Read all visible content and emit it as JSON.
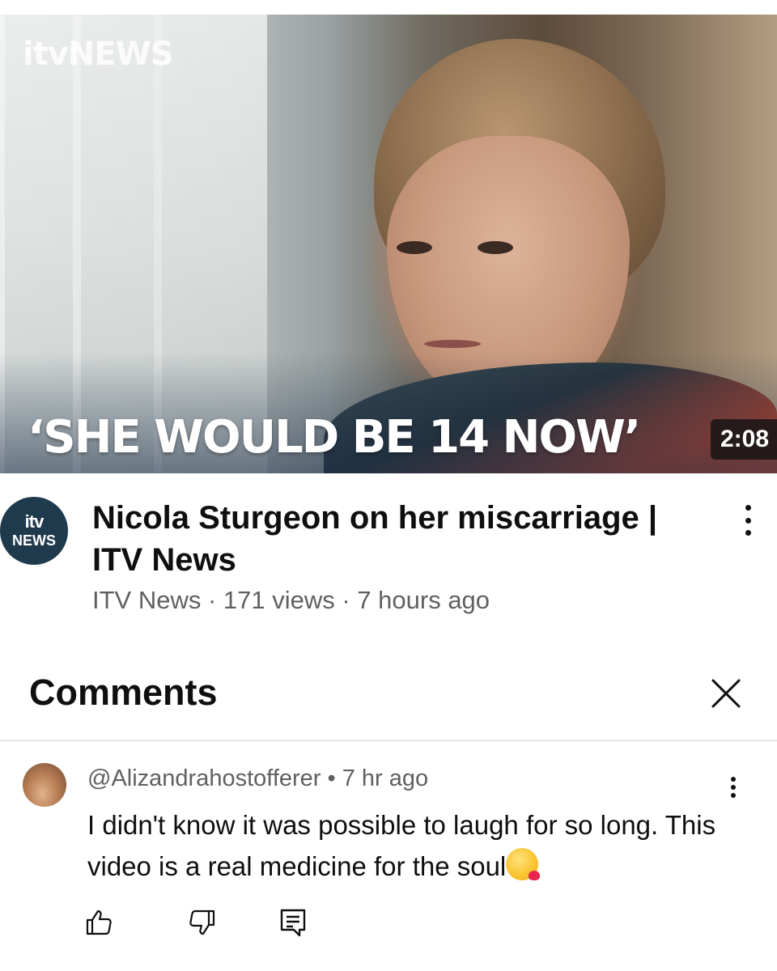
{
  "video": {
    "thumbnail": {
      "channel_logo_text": "itvNEWS",
      "caption": "‘SHE WOULD BE 14 NOW’",
      "duration": "2:08"
    },
    "channel_avatar": {
      "line1": "itv",
      "line2": "NEWS"
    },
    "title": "Nicola Sturgeon on her miscarriage | ITV News",
    "meta": "ITV News · 171 views · 7 hours ago"
  },
  "comments": {
    "heading": "Comments",
    "items": [
      {
        "author": "@Alizandrahostofferer",
        "time": "7 hr ago",
        "author_line": "@Alizandrahostofferer • 7 hr ago",
        "text": "I didn't know it was possible to laugh for so long. This video is a real medicine for the soul",
        "emoji": "face-blowing-a-kiss"
      }
    ]
  },
  "icons": {
    "more": "more-vert-icon",
    "close": "close-icon",
    "like": "thumb-up-icon",
    "dislike": "thumb-down-icon",
    "reply": "reply-comment-icon"
  },
  "colors": {
    "text_primary": "#0f0f0f",
    "text_secondary": "#606060",
    "divider": "#e5e5e5",
    "channel_avatar_bg": "#1f3a4d"
  }
}
